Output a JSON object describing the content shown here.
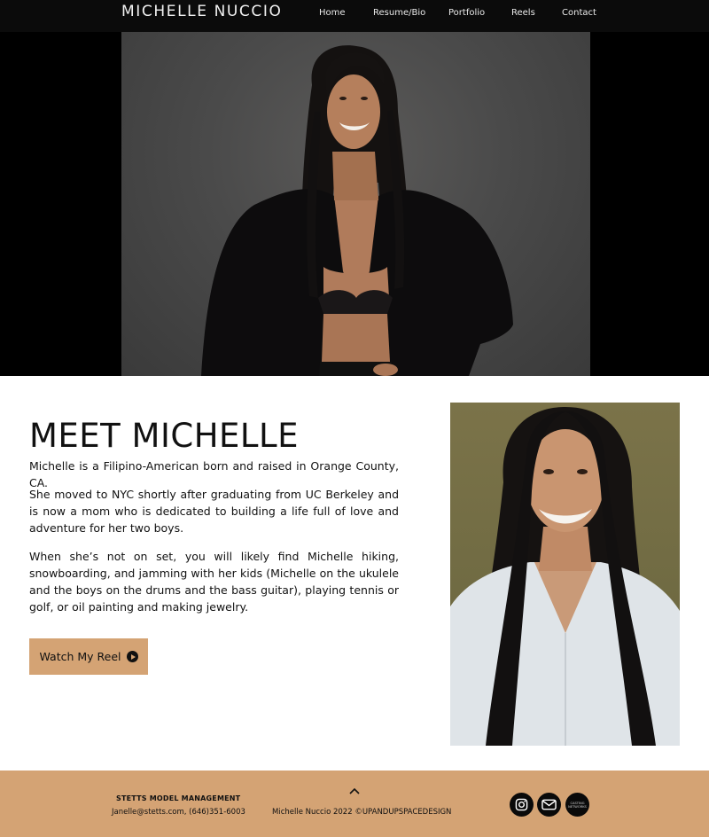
{
  "header": {
    "brand": "MICHELLE NUCCIO",
    "nav": [
      "Home",
      "Resume/Bio",
      "Portfolio",
      "Reels",
      "Contact"
    ]
  },
  "meet": {
    "title": "MEET MICHELLE",
    "paragraphs": [
      "Michelle is a Filipino-American born and raised in Orange County, CA.",
      "She moved to NYC shortly after graduating from UC Berkeley and is now a mom who is dedicated to building a life full of love and adventure for her two boys.",
      "When she’s not on set, you will likely find Michelle hiking, snowboarding, and jamming with her kids (Michelle on the ukulele and the boys on the drums and the bass guitar), playing tennis or golf, or oil painting and making jewelry."
    ],
    "button_label": "Watch My Reel"
  },
  "footer": {
    "agency_name": "STETTS MODEL MANAGEMENT",
    "agency_contact": "Janelle@stetts.com, (646)351-6003",
    "copyright": "Michelle Nuccio 2022 ©UPANDUPSPACEDESIGN",
    "social_icons": [
      "instagram-icon",
      "mail-icon",
      "casting-networks-icon"
    ],
    "casting_networks_label_1": "CASTING",
    "casting_networks_label_2": "NETWORKS"
  },
  "colors": {
    "header_bg": "#0b0b0b",
    "accent": "#d4a374",
    "text": "#111111"
  }
}
